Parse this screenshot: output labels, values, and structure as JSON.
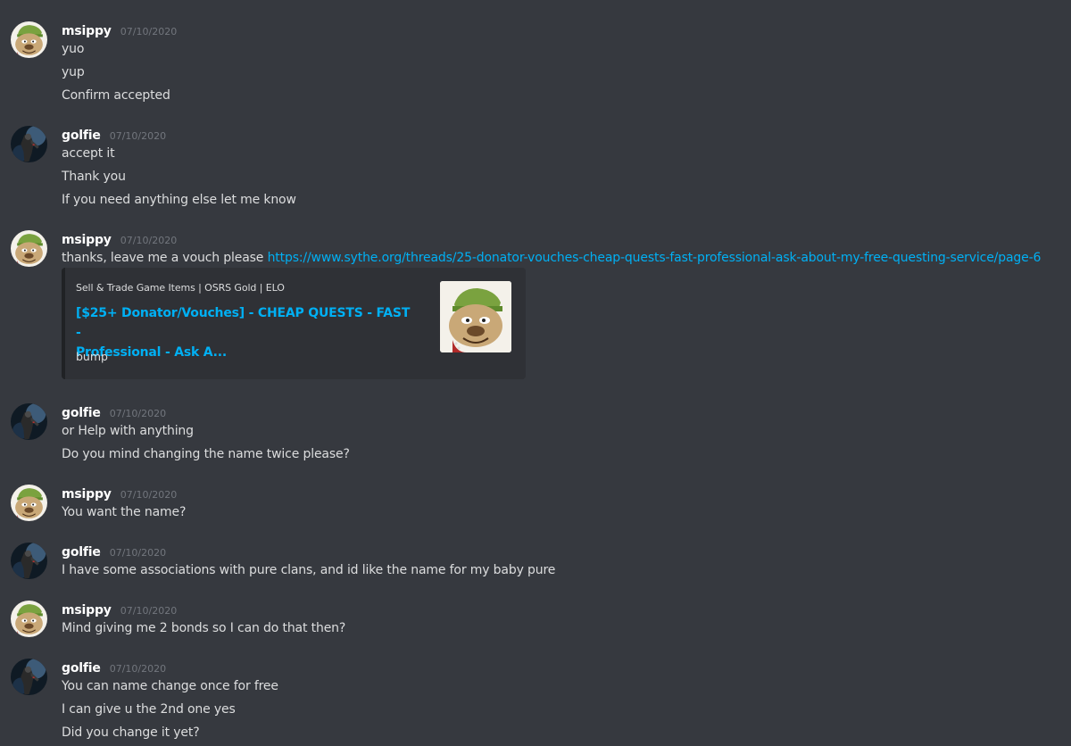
{
  "messages": [
    {
      "username": "msippy",
      "timestamp": "07/10/2020",
      "avatar_icon": "bulldog-icon",
      "lines": [
        "yuo",
        "yup",
        "Confirm accepted"
      ]
    },
    {
      "username": "golfie",
      "timestamp": "07/10/2020",
      "avatar_icon": "dark-figure-icon",
      "lines": [
        "accept it",
        "Thank you",
        "If you need anything else let me know"
      ]
    },
    {
      "username": "msippy",
      "timestamp": "07/10/2020",
      "avatar_icon": "bulldog-icon",
      "text_before_link": "thanks, leave me a vouch please ",
      "link": "https://www.sythe.org/threads/25-donator-vouches-cheap-quests-fast-professional-ask-about-my-free-questing-service/page-6",
      "embed": {
        "provider": "Sell & Trade Game Items | OSRS Gold | ELO",
        "title_line1": "[$25+ Donator/Vouches] - CHEAP QUESTS - FAST -",
        "title_line2": "Professional - Ask A...",
        "description": "bump",
        "thumbnail_icon": "bulldog-thumbnail-icon"
      }
    },
    {
      "username": "golfie",
      "timestamp": "07/10/2020",
      "avatar_icon": "dark-figure-icon",
      "lines": [
        "or Help with anything",
        "Do you mind changing the name twice please?"
      ]
    },
    {
      "username": "msippy",
      "timestamp": "07/10/2020",
      "avatar_icon": "bulldog-icon",
      "lines": [
        "You want the name?"
      ]
    },
    {
      "username": "golfie",
      "timestamp": "07/10/2020",
      "avatar_icon": "dark-figure-icon",
      "lines": [
        "I have some associations with pure clans, and id like the name for my baby pure"
      ]
    },
    {
      "username": "msippy",
      "timestamp": "07/10/2020",
      "avatar_icon": "bulldog-icon",
      "lines": [
        "Mind giving me 2 bonds so I can do that then?"
      ]
    },
    {
      "username": "golfie",
      "timestamp": "07/10/2020",
      "avatar_icon": "dark-figure-icon",
      "lines": [
        "You can name change once for free",
        "I can give u the 2nd one yes",
        "Did you change it yet?"
      ]
    }
  ],
  "colors": {
    "background": "#36393f",
    "username": "#ffffff",
    "timestamp": "#72767d",
    "text": "#dcddde",
    "link": "#00b0f4",
    "embed_background": "#2f3136"
  }
}
